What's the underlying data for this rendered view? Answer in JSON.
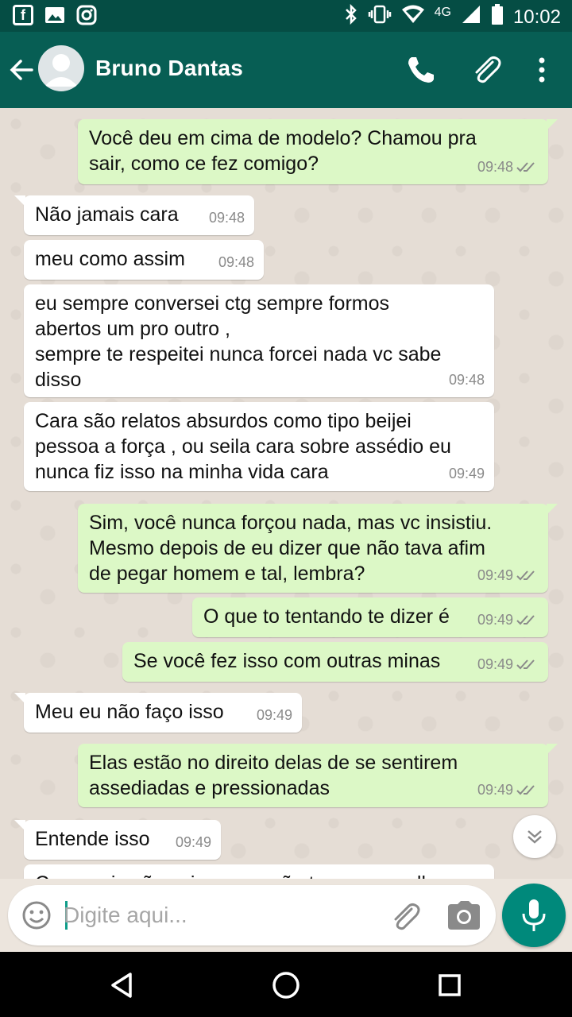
{
  "status_bar": {
    "time": "10:02",
    "network": "4G"
  },
  "header": {
    "contact_name": "Bruno Dantas"
  },
  "messages": [
    {
      "dir": "out",
      "text": "Você deu em cima de modelo? Chamou pra\nsair, como ce fez comigo?",
      "time": "09:48"
    },
    {
      "dir": "in",
      "text": "Não jamais cara",
      "time": "09:48"
    },
    {
      "dir": "in",
      "text": "meu como assim",
      "time": "09:48"
    },
    {
      "dir": "in",
      "text": "eu sempre conversei ctg sempre formos\nabertos um pro outro ,\nsempre te respeitei nunca forcei nada vc sabe\ndisso",
      "time": "09:48"
    },
    {
      "dir": "in",
      "text": "Cara são relatos absurdos como tipo beijei\npessoa a força , ou seila cara sobre assédio eu\nnunca fiz isso na minha vida cara",
      "time": "09:49"
    },
    {
      "dir": "out",
      "text": "Sim, você nunca forçou nada, mas vc insistiu.\nMesmo depois de eu dizer que não tava afim\nde pegar homem e tal, lembra?",
      "time": "09:49"
    },
    {
      "dir": "out",
      "text": "O que to tentando te dizer é",
      "time": "09:49"
    },
    {
      "dir": "out",
      "text": "Se você fez isso com outras minas",
      "time": "09:49"
    },
    {
      "dir": "in",
      "text": "Meu eu não faço isso",
      "time": "09:49"
    },
    {
      "dir": "out",
      "text": "Elas estão no direito delas de se sentirem\nassediadas e pressionadas",
      "time": "09:49"
    },
    {
      "dir": "in",
      "text": "Entende isso",
      "time": "09:49"
    },
    {
      "dir": "in",
      "text": "Cara meio são coisas que não tem nexo velho",
      "time": ""
    }
  ],
  "composer": {
    "placeholder": "Digite aqui..."
  },
  "colors": {
    "header": "#075e54",
    "status_bar": "#054d44",
    "outgoing_bubble": "#dcf8c6",
    "incoming_bubble": "#ffffff",
    "read_ticks": "#8a8a8a",
    "mic_button": "#00897b"
  },
  "icons": {
    "status_left": [
      "facebook-icon",
      "gallery-icon",
      "instagram-icon"
    ],
    "status_right": [
      "bluetooth-icon",
      "vibrate-icon",
      "wifi-icon",
      "signal-icon",
      "battery-icon"
    ],
    "header": [
      "back-arrow-icon",
      "avatar",
      "phone-icon",
      "attach-icon",
      "more-vert-icon"
    ],
    "composer": [
      "emoji-icon",
      "attach-icon",
      "camera-icon",
      "mic-icon"
    ],
    "nav": [
      "back-triangle-icon",
      "home-circle-icon",
      "recents-square-icon"
    ]
  }
}
